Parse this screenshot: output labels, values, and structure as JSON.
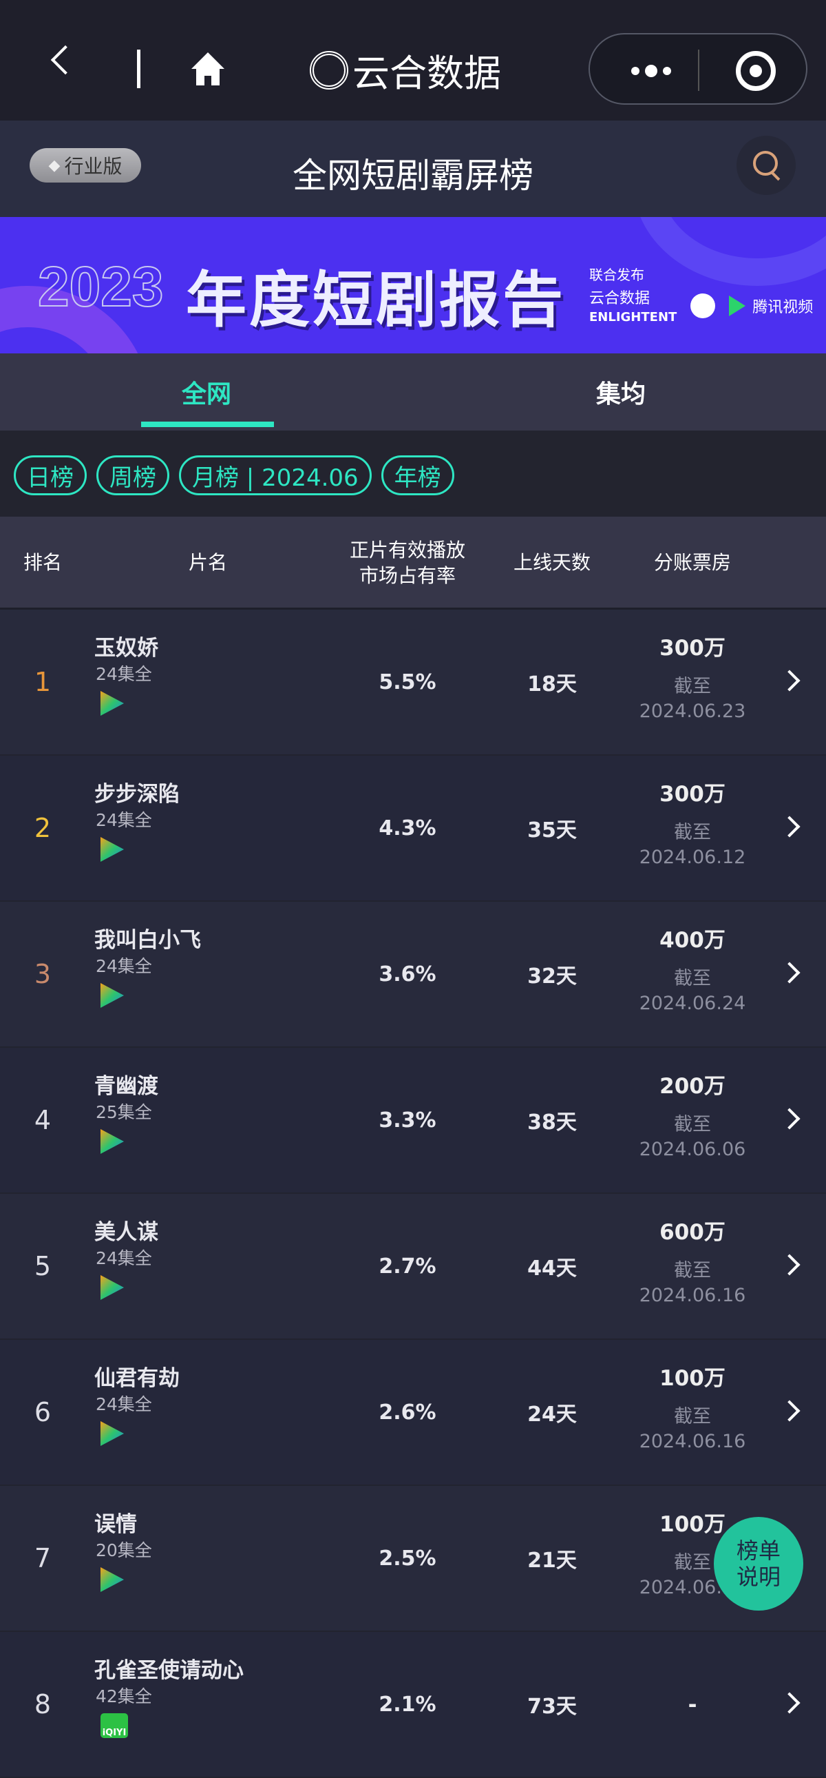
{
  "topbar": {
    "app_title": "云合数据"
  },
  "header": {
    "badge": "行业版",
    "badge_icon": "diamond-icon",
    "title": "全网短剧霸屏榜"
  },
  "banner": {
    "year": "2023",
    "title": "年度短剧报告",
    "joint": "联合发布",
    "partner1": "云合数据",
    "partner1_en": "ENLIGHTENT",
    "partner3": "腾讯视频"
  },
  "tabs": [
    {
      "label": "全网",
      "active": true
    },
    {
      "label": "集均",
      "active": false
    }
  ],
  "filters": [
    "日榜",
    "周榜",
    "月榜 | 2024.06",
    "年榜"
  ],
  "columns": {
    "rank": "排名",
    "name": "片名",
    "share_line1": "正片有效播放",
    "share_line2": "市场占有率",
    "days": "上线天数",
    "box": "分账票房"
  },
  "rank_colors": {
    "1": "#e8963a",
    "2": "#f0c23c",
    "3": "#c98a6c"
  },
  "rows": [
    {
      "rank": "1",
      "name": "玉奴娇",
      "episodes": "24集全",
      "platform": "tencent-video",
      "share": "5.5%",
      "days": "18天",
      "box": "300万",
      "as_of": "截至",
      "date": "2024.06.23"
    },
    {
      "rank": "2",
      "name": "步步深陷",
      "episodes": "24集全",
      "platform": "tencent-video",
      "share": "4.3%",
      "days": "35天",
      "box": "300万",
      "as_of": "截至",
      "date": "2024.06.12"
    },
    {
      "rank": "3",
      "name": "我叫白小飞",
      "episodes": "24集全",
      "platform": "tencent-video",
      "share": "3.6%",
      "days": "32天",
      "box": "400万",
      "as_of": "截至",
      "date": "2024.06.24"
    },
    {
      "rank": "4",
      "name": "青幽渡",
      "episodes": "25集全",
      "platform": "tencent-video",
      "share": "3.3%",
      "days": "38天",
      "box": "200万",
      "as_of": "截至",
      "date": "2024.06.06"
    },
    {
      "rank": "5",
      "name": "美人谋",
      "episodes": "24集全",
      "platform": "tencent-video",
      "share": "2.7%",
      "days": "44天",
      "box": "600万",
      "as_of": "截至",
      "date": "2024.06.16"
    },
    {
      "rank": "6",
      "name": "仙君有劫",
      "episodes": "24集全",
      "platform": "tencent-video",
      "share": "2.6%",
      "days": "24天",
      "box": "100万",
      "as_of": "截至",
      "date": "2024.06.16"
    },
    {
      "rank": "7",
      "name": "误情",
      "episodes": "20集全",
      "platform": "tencent-video",
      "share": "2.5%",
      "days": "21天",
      "box": "100万",
      "as_of": "截至",
      "date": "2024.06.17"
    },
    {
      "rank": "8",
      "name": "孔雀圣使请动心",
      "episodes": "42集全",
      "platform": "iqiyi",
      "platform_text": "iQIYI",
      "share": "2.1%",
      "days": "73天",
      "box": "-"
    }
  ],
  "fab": {
    "line1": "榜单",
    "line2": "说明"
  }
}
